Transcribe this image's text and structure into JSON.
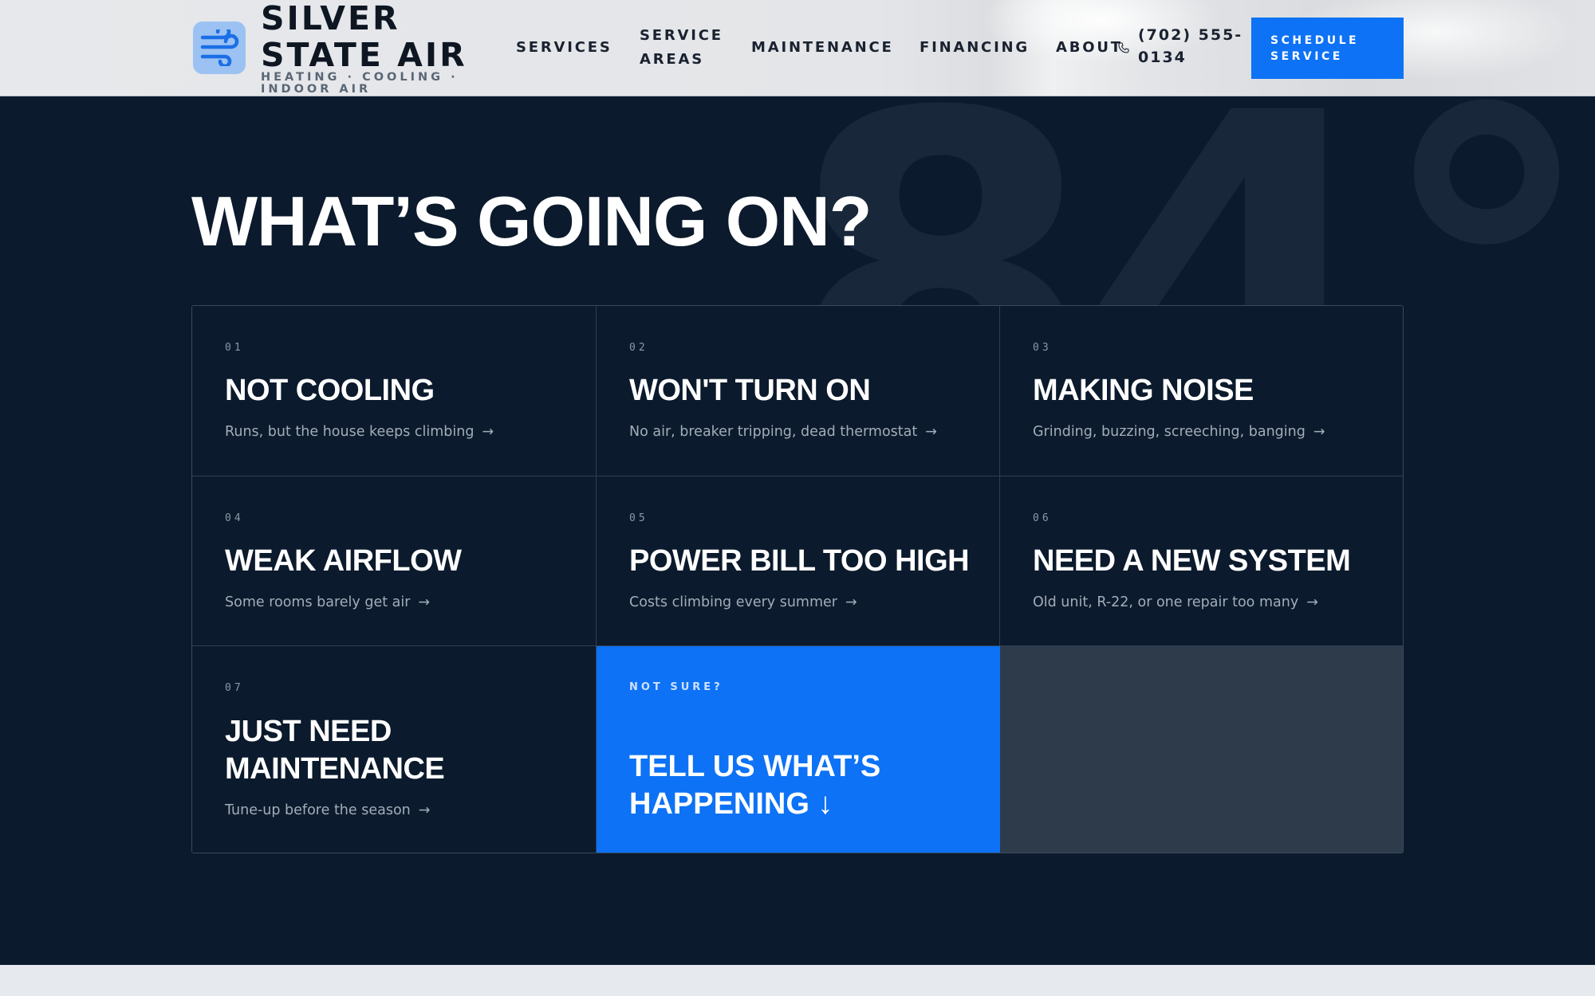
{
  "brand": {
    "name_line1": "SILVER",
    "name_line2": "STATE AIR",
    "tagline": "HEATING · COOLING · INDOOR AIR",
    "logo_icon": "wind-icon"
  },
  "nav": {
    "items": [
      {
        "label": "SERVICES"
      },
      {
        "label": "SERVICE AREAS"
      },
      {
        "label": "MAINTENANCE"
      },
      {
        "label": "FINANCING"
      },
      {
        "label": "ABOUT"
      }
    ],
    "phone": "(702) 555-0134",
    "phone_icon": "phone-icon",
    "cta": "SCHEDULE SERVICE",
    "cta_color": "#0d72f5"
  },
  "hero": {
    "background_number": "84°",
    "headline": "WHAT’S GOING ON?"
  },
  "issues": [
    {
      "num": "01",
      "title": "NOT COOLING",
      "sub": "Runs, but the house keeps climbing"
    },
    {
      "num": "02",
      "title": "WON'T TURN ON",
      "sub": "No air, breaker tripping, dead thermostat"
    },
    {
      "num": "03",
      "title": "MAKING NOISE",
      "sub": "Grinding, buzzing, screeching, banging"
    },
    {
      "num": "04",
      "title": "WEAK AIRFLOW",
      "sub": "Some rooms barely get air"
    },
    {
      "num": "05",
      "title": "POWER BILL TOO HIGH",
      "sub": "Costs climbing every summer"
    },
    {
      "num": "06",
      "title": "NEED A NEW SYSTEM",
      "sub": "Old unit, R-22, or one repair too many"
    },
    {
      "num": "07",
      "title": "JUST NEED MAINTENANCE",
      "sub": "Tune-up before the season"
    }
  ],
  "arrow": "→",
  "not_sure": {
    "kicker": "NOT SURE?",
    "title": "TELL US WHAT’S HAPPENING",
    "arrow": "↓"
  },
  "colors": {
    "background": "#0b1a2c",
    "accent": "#0d72f5",
    "panel_gray": "#2e3b4b"
  }
}
